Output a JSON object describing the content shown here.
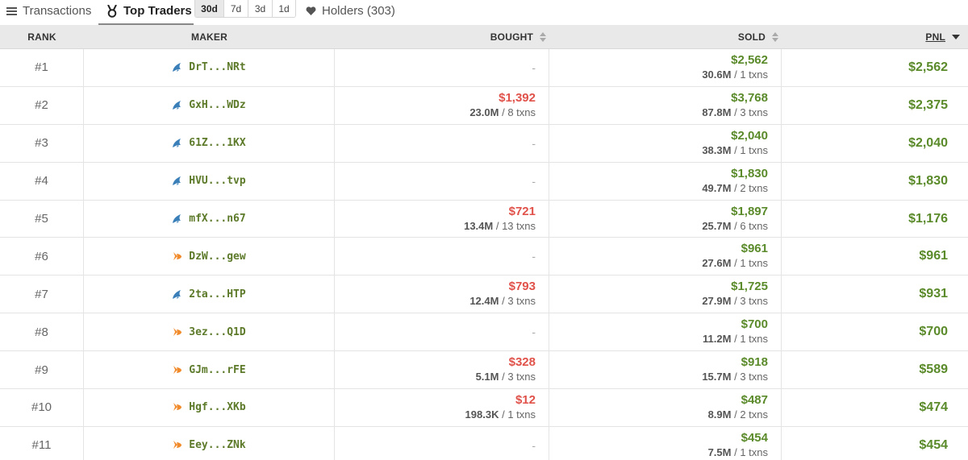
{
  "tabs": {
    "transactions": "Transactions",
    "top_traders": "Top Traders",
    "holders": "Holders (303)"
  },
  "ranges": [
    "30d",
    "7d",
    "3d",
    "1d"
  ],
  "active_range": "30d",
  "columns": {
    "rank": "RANK",
    "maker": "MAKER",
    "bought": "BOUGHT",
    "sold": "SOLD",
    "pnl": "PNL"
  },
  "colors": {
    "negative": "#e0524a",
    "positive": "#5a8a2a",
    "address": "#5d7a2a"
  },
  "rows": [
    {
      "rank": "#1",
      "icon": "whale-icon",
      "maker": "DrT...NRt",
      "bought": null,
      "bought_sub": null,
      "sold": "$2,562",
      "sold_tokens": "30.6M",
      "sold_txns": "1 txns",
      "pnl": "$2,562"
    },
    {
      "rank": "#2",
      "icon": "whale-icon",
      "maker": "GxH...WDz",
      "bought": "$1,392",
      "bought_tokens": "23.0M",
      "bought_txns": "8 txns",
      "sold": "$3,768",
      "sold_tokens": "87.8M",
      "sold_txns": "3 txns",
      "pnl": "$2,375"
    },
    {
      "rank": "#3",
      "icon": "whale-icon",
      "maker": "61Z...1KX",
      "bought": null,
      "sold": "$2,040",
      "sold_tokens": "38.3M",
      "sold_txns": "1 txns",
      "pnl": "$2,040"
    },
    {
      "rank": "#4",
      "icon": "whale-icon",
      "maker": "HVU...tvp",
      "bought": null,
      "sold": "$1,830",
      "sold_tokens": "49.7M",
      "sold_txns": "2 txns",
      "pnl": "$1,830"
    },
    {
      "rank": "#5",
      "icon": "whale-icon",
      "maker": "mfX...n67",
      "bought": "$721",
      "bought_tokens": "13.4M",
      "bought_txns": "13 txns",
      "sold": "$1,897",
      "sold_tokens": "25.7M",
      "sold_txns": "6 txns",
      "pnl": "$1,176"
    },
    {
      "rank": "#6",
      "icon": "fish-icon",
      "maker": "DzW...gew",
      "bought": null,
      "sold": "$961",
      "sold_tokens": "27.6M",
      "sold_txns": "1 txns",
      "pnl": "$961"
    },
    {
      "rank": "#7",
      "icon": "whale-icon",
      "maker": "2ta...HTP",
      "bought": "$793",
      "bought_tokens": "12.4M",
      "bought_txns": "3 txns",
      "sold": "$1,725",
      "sold_tokens": "27.9M",
      "sold_txns": "3 txns",
      "pnl": "$931"
    },
    {
      "rank": "#8",
      "icon": "fish-icon",
      "maker": "3ez...Q1D",
      "bought": null,
      "sold": "$700",
      "sold_tokens": "11.2M",
      "sold_txns": "1 txns",
      "pnl": "$700"
    },
    {
      "rank": "#9",
      "icon": "fish-icon",
      "maker": "GJm...rFE",
      "bought": "$328",
      "bought_tokens": "5.1M",
      "bought_txns": "3 txns",
      "sold": "$918",
      "sold_tokens": "15.7M",
      "sold_txns": "3 txns",
      "pnl": "$589"
    },
    {
      "rank": "#10",
      "icon": "fish-icon",
      "maker": "Hgf...XKb",
      "bought": "$12",
      "bought_tokens": "198.3K",
      "bought_txns": "1 txns",
      "sold": "$487",
      "sold_tokens": "8.9M",
      "sold_txns": "2 txns",
      "pnl": "$474"
    },
    {
      "rank": "#11",
      "icon": "fish-icon",
      "maker": "Eey...ZNk",
      "bought": null,
      "sold": "$454",
      "sold_tokens": "7.5M",
      "sold_txns": "1 txns",
      "pnl": "$454"
    }
  ]
}
